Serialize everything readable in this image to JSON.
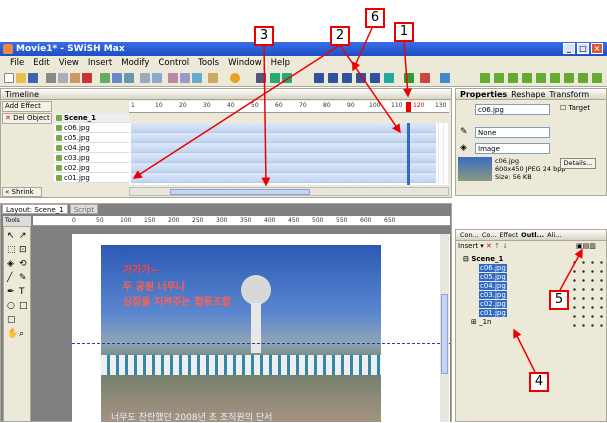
{
  "window": {
    "title": "Movie1* - SWiSH Max"
  },
  "menu": [
    "File",
    "Edit",
    "View",
    "Insert",
    "Modify",
    "Control",
    "Tools",
    "Window",
    "Help"
  ],
  "timeline": {
    "title": "Timeline",
    "add_effect": "Add Effect",
    "del_object": "Del Object",
    "shrink": "Shrink",
    "scene": "Scene_1",
    "rows": [
      "c06.jpg",
      "c05.jpg",
      "c04.jpg",
      "c03.jpg",
      "c02.jpg",
      "c01.jpg"
    ],
    "ruler": [
      "1",
      "10",
      "20",
      "30",
      "40",
      "50",
      "60",
      "70",
      "80",
      "90",
      "100",
      "110",
      "120",
      "130"
    ]
  },
  "layout": {
    "tab1": "Layout: Scene_1",
    "tab2": "Script",
    "tools": "Tools",
    "ruler": [
      "0",
      "50",
      "100",
      "150",
      "200",
      "250",
      "300",
      "350",
      "400",
      "450",
      "500",
      "550",
      "600",
      "650"
    ],
    "photo_text": [
      "가가가~",
      "두 공원 너무나",
      "심장을 지켜주는 협동조합"
    ],
    "bottom_text": "너무도 찬란했던 2008년 초 조직원의 단서"
  },
  "properties": {
    "tabs": [
      "Properties",
      "Reshape",
      "Transform"
    ],
    "name": "c06.jpg",
    "target": "Target",
    "line": "None",
    "fill": "Image",
    "info": [
      "c06.jpg",
      "600x450 JPEG 24 bpp",
      "Size: 56 KB"
    ],
    "details": "Details..."
  },
  "outline": {
    "tabs": [
      "Con...",
      "Co...",
      "Effect",
      "Outl...",
      "Ali..."
    ],
    "insert": "Insert",
    "scene": "Scene_1",
    "items": [
      "c06.jpg",
      "c05.jpg",
      "c04.jpg",
      "c03.jpg",
      "c02.jpg",
      "c01.jpg"
    ],
    "bg": "_1n"
  },
  "annotations": [
    "1",
    "2",
    "3",
    "4",
    "5",
    "6"
  ],
  "colors": {
    "annotation": "#e00000",
    "selection": "#316ac5",
    "xp_title": "#1d4fc4"
  }
}
